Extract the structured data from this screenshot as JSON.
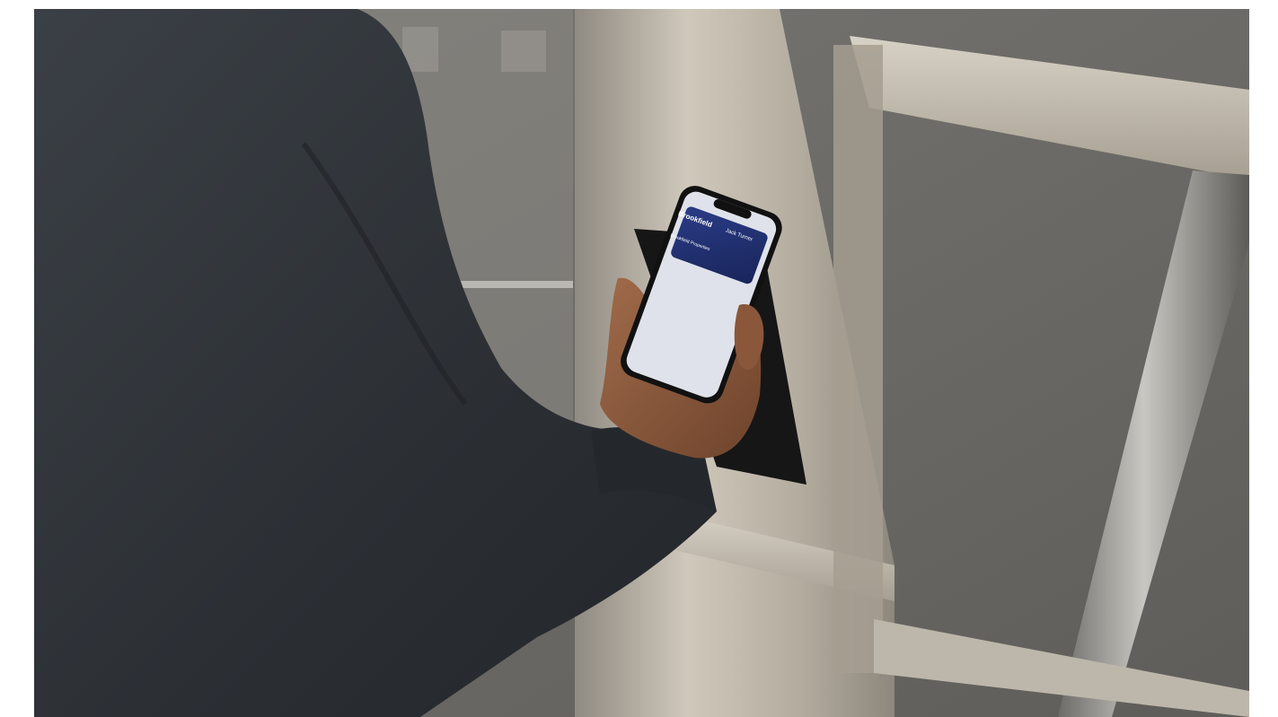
{
  "scene": {
    "caption": "",
    "phone": {
      "wallet_card": {
        "brand": "Brookfield",
        "holder_name": "Jack Turner",
        "card_label": "Brookfield Properties",
        "card_color": "#1f2e6e"
      },
      "screen_color": "#dfe2ea"
    },
    "colors": {
      "wall": "#6d6b67",
      "steel": "#b9b2a6",
      "suit": "#2e3237",
      "skin": "#8a5a3e"
    }
  }
}
